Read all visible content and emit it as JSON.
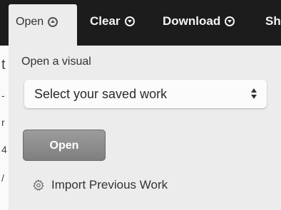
{
  "toolbar": {
    "open_label": "Open",
    "clear_label": "Clear",
    "download_label": "Download",
    "share_label": "Sh"
  },
  "panel": {
    "heading": "Open a visual",
    "select": {
      "selected_value": "Select your saved work",
      "icon": "updown-arrows-icon"
    },
    "open_button_label": "Open",
    "import_link": {
      "label": "Import Previous Work",
      "icon": "gear-icon"
    }
  },
  "left_edge": {
    "chars": [
      "t",
      "-",
      "r",
      "4",
      "/"
    ]
  }
}
